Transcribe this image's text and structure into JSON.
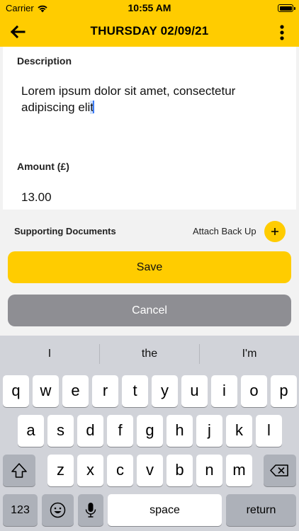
{
  "status_bar": {
    "carrier": "Carrier",
    "time": "10:55 AM"
  },
  "header": {
    "title": "THURSDAY 02/09/21",
    "back_icon": "arrow-left-icon",
    "more_icon": "more-vertical-icon"
  },
  "form": {
    "description_label": "Description",
    "description_value_line1": "Lorem ipsum dolor sit amet, consectetur",
    "description_value_line2": "adipiscing eli",
    "description_value_sel": "t",
    "amount_label": "Amount (£)",
    "amount_value": "13.00"
  },
  "documents": {
    "label": "Supporting Documents",
    "attach_label": "Attach Back Up",
    "attach_icon": "plus-icon"
  },
  "actions": {
    "save_label": "Save",
    "cancel_label": "Cancel"
  },
  "keyboard": {
    "suggestions": [
      "I",
      "the",
      "I'm"
    ],
    "row1": [
      "q",
      "w",
      "e",
      "r",
      "t",
      "y",
      "u",
      "i",
      "o",
      "p"
    ],
    "row2": [
      "a",
      "s",
      "d",
      "f",
      "g",
      "h",
      "j",
      "k",
      "l"
    ],
    "row3": [
      "z",
      "x",
      "c",
      "v",
      "b",
      "n",
      "m"
    ],
    "numbers_label": "123",
    "space_label": "space",
    "return_label": "return"
  },
  "colors": {
    "accent": "#ffcc00",
    "cancel": "#8e8e93",
    "keyboard_bg": "#d1d3d9"
  }
}
